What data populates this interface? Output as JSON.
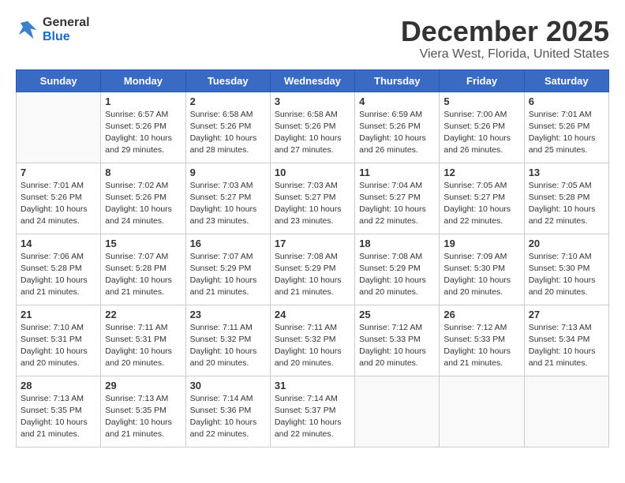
{
  "header": {
    "logo_general": "General",
    "logo_blue": "Blue",
    "month_title": "December 2025",
    "location": "Viera West, Florida, United States"
  },
  "weekdays": [
    "Sunday",
    "Monday",
    "Tuesday",
    "Wednesday",
    "Thursday",
    "Friday",
    "Saturday"
  ],
  "weeks": [
    [
      {
        "day": "",
        "info": ""
      },
      {
        "day": "1",
        "info": "Sunrise: 6:57 AM\nSunset: 5:26 PM\nDaylight: 10 hours\nand 29 minutes."
      },
      {
        "day": "2",
        "info": "Sunrise: 6:58 AM\nSunset: 5:26 PM\nDaylight: 10 hours\nand 28 minutes."
      },
      {
        "day": "3",
        "info": "Sunrise: 6:58 AM\nSunset: 5:26 PM\nDaylight: 10 hours\nand 27 minutes."
      },
      {
        "day": "4",
        "info": "Sunrise: 6:59 AM\nSunset: 5:26 PM\nDaylight: 10 hours\nand 26 minutes."
      },
      {
        "day": "5",
        "info": "Sunrise: 7:00 AM\nSunset: 5:26 PM\nDaylight: 10 hours\nand 26 minutes."
      },
      {
        "day": "6",
        "info": "Sunrise: 7:01 AM\nSunset: 5:26 PM\nDaylight: 10 hours\nand 25 minutes."
      }
    ],
    [
      {
        "day": "7",
        "info": "Sunrise: 7:01 AM\nSunset: 5:26 PM\nDaylight: 10 hours\nand 24 minutes."
      },
      {
        "day": "8",
        "info": "Sunrise: 7:02 AM\nSunset: 5:26 PM\nDaylight: 10 hours\nand 24 minutes."
      },
      {
        "day": "9",
        "info": "Sunrise: 7:03 AM\nSunset: 5:27 PM\nDaylight: 10 hours\nand 23 minutes."
      },
      {
        "day": "10",
        "info": "Sunrise: 7:03 AM\nSunset: 5:27 PM\nDaylight: 10 hours\nand 23 minutes."
      },
      {
        "day": "11",
        "info": "Sunrise: 7:04 AM\nSunset: 5:27 PM\nDaylight: 10 hours\nand 22 minutes."
      },
      {
        "day": "12",
        "info": "Sunrise: 7:05 AM\nSunset: 5:27 PM\nDaylight: 10 hours\nand 22 minutes."
      },
      {
        "day": "13",
        "info": "Sunrise: 7:05 AM\nSunset: 5:28 PM\nDaylight: 10 hours\nand 22 minutes."
      }
    ],
    [
      {
        "day": "14",
        "info": "Sunrise: 7:06 AM\nSunset: 5:28 PM\nDaylight: 10 hours\nand 21 minutes."
      },
      {
        "day": "15",
        "info": "Sunrise: 7:07 AM\nSunset: 5:28 PM\nDaylight: 10 hours\nand 21 minutes."
      },
      {
        "day": "16",
        "info": "Sunrise: 7:07 AM\nSunset: 5:29 PM\nDaylight: 10 hours\nand 21 minutes."
      },
      {
        "day": "17",
        "info": "Sunrise: 7:08 AM\nSunset: 5:29 PM\nDaylight: 10 hours\nand 21 minutes."
      },
      {
        "day": "18",
        "info": "Sunrise: 7:08 AM\nSunset: 5:29 PM\nDaylight: 10 hours\nand 20 minutes."
      },
      {
        "day": "19",
        "info": "Sunrise: 7:09 AM\nSunset: 5:30 PM\nDaylight: 10 hours\nand 20 minutes."
      },
      {
        "day": "20",
        "info": "Sunrise: 7:10 AM\nSunset: 5:30 PM\nDaylight: 10 hours\nand 20 minutes."
      }
    ],
    [
      {
        "day": "21",
        "info": "Sunrise: 7:10 AM\nSunset: 5:31 PM\nDaylight: 10 hours\nand 20 minutes."
      },
      {
        "day": "22",
        "info": "Sunrise: 7:11 AM\nSunset: 5:31 PM\nDaylight: 10 hours\nand 20 minutes."
      },
      {
        "day": "23",
        "info": "Sunrise: 7:11 AM\nSunset: 5:32 PM\nDaylight: 10 hours\nand 20 minutes."
      },
      {
        "day": "24",
        "info": "Sunrise: 7:11 AM\nSunset: 5:32 PM\nDaylight: 10 hours\nand 20 minutes."
      },
      {
        "day": "25",
        "info": "Sunrise: 7:12 AM\nSunset: 5:33 PM\nDaylight: 10 hours\nand 20 minutes."
      },
      {
        "day": "26",
        "info": "Sunrise: 7:12 AM\nSunset: 5:33 PM\nDaylight: 10 hours\nand 21 minutes."
      },
      {
        "day": "27",
        "info": "Sunrise: 7:13 AM\nSunset: 5:34 PM\nDaylight: 10 hours\nand 21 minutes."
      }
    ],
    [
      {
        "day": "28",
        "info": "Sunrise: 7:13 AM\nSunset: 5:35 PM\nDaylight: 10 hours\nand 21 minutes."
      },
      {
        "day": "29",
        "info": "Sunrise: 7:13 AM\nSunset: 5:35 PM\nDaylight: 10 hours\nand 21 minutes."
      },
      {
        "day": "30",
        "info": "Sunrise: 7:14 AM\nSunset: 5:36 PM\nDaylight: 10 hours\nand 22 minutes."
      },
      {
        "day": "31",
        "info": "Sunrise: 7:14 AM\nSunset: 5:37 PM\nDaylight: 10 hours\nand 22 minutes."
      },
      {
        "day": "",
        "info": ""
      },
      {
        "day": "",
        "info": ""
      },
      {
        "day": "",
        "info": ""
      }
    ]
  ]
}
